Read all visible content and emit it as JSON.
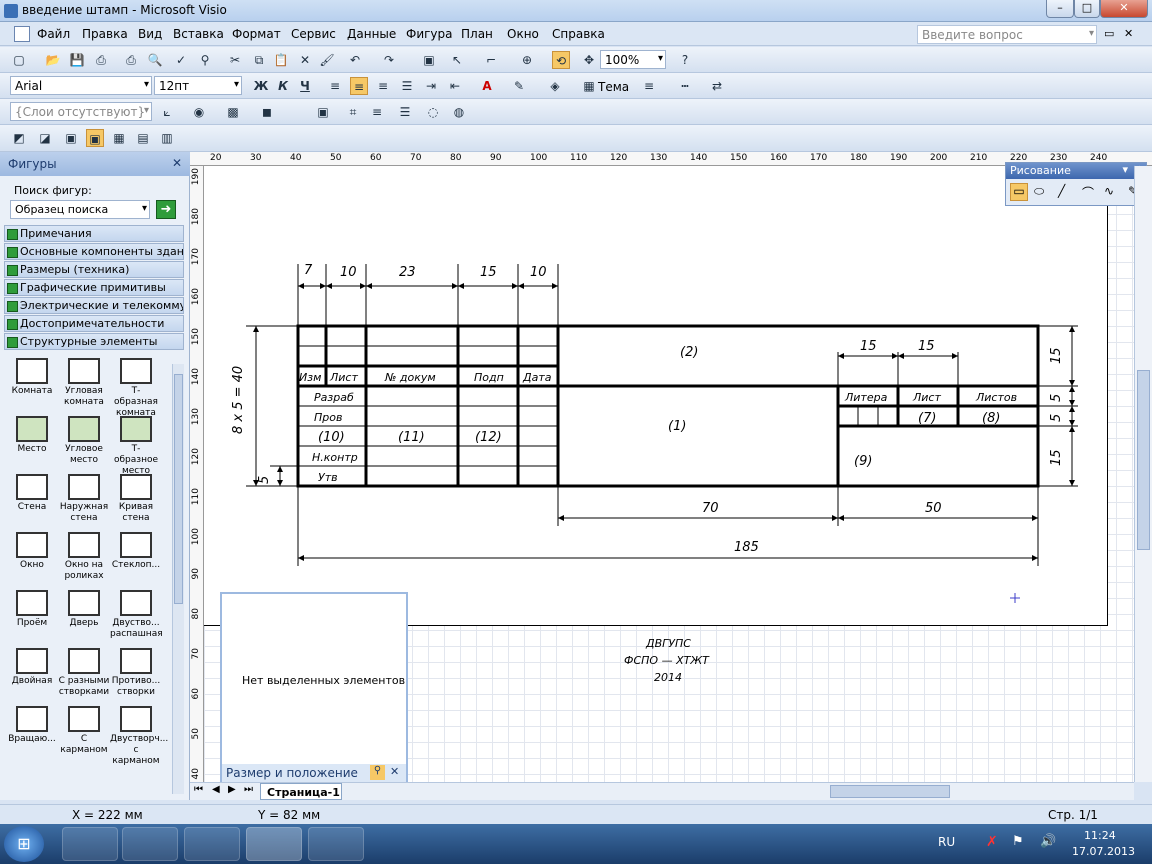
{
  "window": {
    "title": "введение штамп - Microsoft Visio",
    "help_placeholder": "Введите вопрос"
  },
  "menu": [
    "Файл",
    "Правка",
    "Вид",
    "Вставка",
    "Формат",
    "Сервис",
    "Данные",
    "Фигура",
    "План",
    "Окно",
    "Справка"
  ],
  "toolbar": {
    "zoom": "100%",
    "font": "Arial",
    "font_size": "12пт",
    "theme": "Тема",
    "layers": "{Слои отсутствуют}"
  },
  "shapes_panel": {
    "title": "Фигуры",
    "search_label": "Поиск фигур:",
    "search_value": "Образец поиска",
    "stencils": [
      "Примечания",
      "Основные компоненты здания",
      "Размеры (техника)",
      "Графические примитивы",
      "Электрические и телекоммун...",
      "Достопримечательности",
      "Структурные элементы"
    ],
    "items": [
      [
        "Комната",
        "Угловая комната",
        "Т-образная комната"
      ],
      [
        "Место",
        "Угловое место",
        "Т-образное место"
      ],
      [
        "Стена",
        "Наружная стена",
        "Кривая стена"
      ],
      [
        "Окно",
        "Окно на роликах",
        "Стеклоп..."
      ],
      [
        "Проём",
        "Дверь",
        "Двуство... распашная"
      ],
      [
        "Двойная",
        "С разными створками",
        "Противо... створки"
      ],
      [
        "Вращаю...",
        "С карманом",
        "Двустворч... с карманом"
      ]
    ]
  },
  "drawing_panel": {
    "title": "Рисование"
  },
  "size_panel": {
    "title": "Размер и положение",
    "message": "Нет выделенных элементов"
  },
  "page_tab": "Страница-1",
  "status": {
    "x": "X = 222 мм",
    "y": "Y = 82 мм",
    "page": "Стр. 1/1"
  },
  "tray": {
    "lang": "RU",
    "time": "11:24",
    "date": "17.07.2013"
  },
  "ruler_h": [
    "20",
    "30",
    "40",
    "50",
    "60",
    "70",
    "80",
    "90",
    "100",
    "110",
    "120",
    "130",
    "140",
    "150",
    "160",
    "170",
    "180",
    "190",
    "200",
    "210",
    "220",
    "230",
    "240"
  ],
  "ruler_v": [
    "190",
    "180",
    "170",
    "160",
    "150",
    "140",
    "130",
    "120",
    "110",
    "100",
    "90",
    "80",
    "70",
    "60",
    "50",
    "40"
  ],
  "stamp": {
    "dims_top": [
      "7",
      "10",
      "23",
      "15",
      "10"
    ],
    "dim_side": "8 x 5 = 40",
    "dim_5": "5",
    "headers": [
      "Изм",
      "Лист",
      "№ докум",
      "Подп",
      "Дата"
    ],
    "rows": [
      "Разраб",
      "Пров",
      "(10)",
      "Н.контр",
      "Утв"
    ],
    "col_11": "(11)",
    "col_12": "(12)",
    "cell_1": "(1)",
    "cell_2": "(2)",
    "cell_9": "(9)",
    "litera": "Литера",
    "list": "Лист",
    "listov": "Листов",
    "cell_7": "(7)",
    "cell_8": "(8)",
    "dim_15a": "15",
    "dim_15b": "15",
    "right_dims": [
      "15",
      "5",
      "5",
      "15"
    ],
    "dim_70": "70",
    "dim_50": "50",
    "dim_185": "185"
  },
  "credit": [
    "ДВГУПС",
    "ФСПО — ХТЖТ",
    "2014"
  ]
}
